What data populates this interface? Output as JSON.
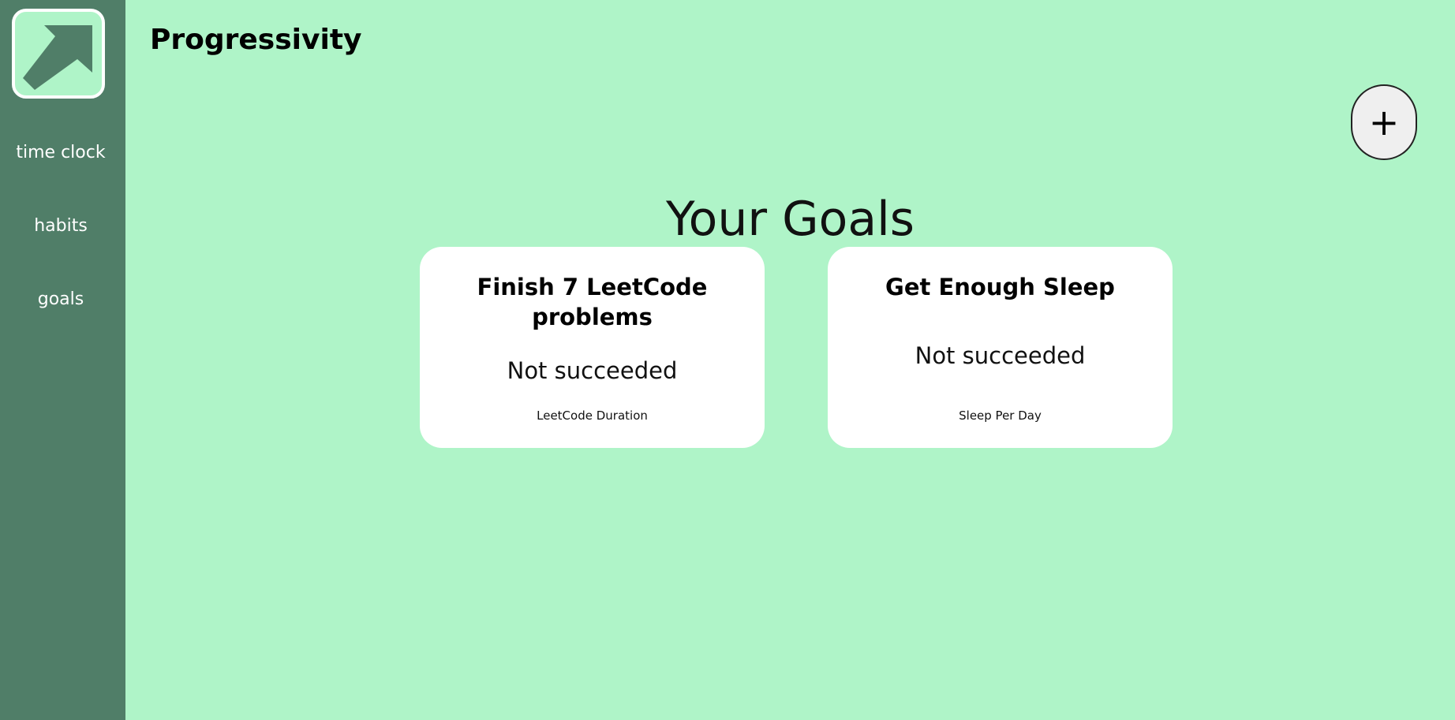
{
  "app": {
    "title": "Progressivity"
  },
  "sidebar": {
    "logo_icon": "arrow-up-right-icon",
    "items": [
      {
        "label": "time clock"
      },
      {
        "label": "habits"
      },
      {
        "label": "goals"
      }
    ]
  },
  "main": {
    "section_title": "Your Goals",
    "add_button": {
      "label": "+",
      "icon": "plus-icon"
    },
    "goals": [
      {
        "title": "Finish 7 LeetCode problems",
        "status": "Not succeeded",
        "metric": "LeetCode Duration"
      },
      {
        "title": "Get Enough Sleep",
        "status": "Not succeeded",
        "metric": "Sleep Per Day"
      }
    ]
  },
  "colors": {
    "background": "#aff4c8",
    "sidebar": "#507e68",
    "card": "#ffffff",
    "button": "#efefef"
  }
}
